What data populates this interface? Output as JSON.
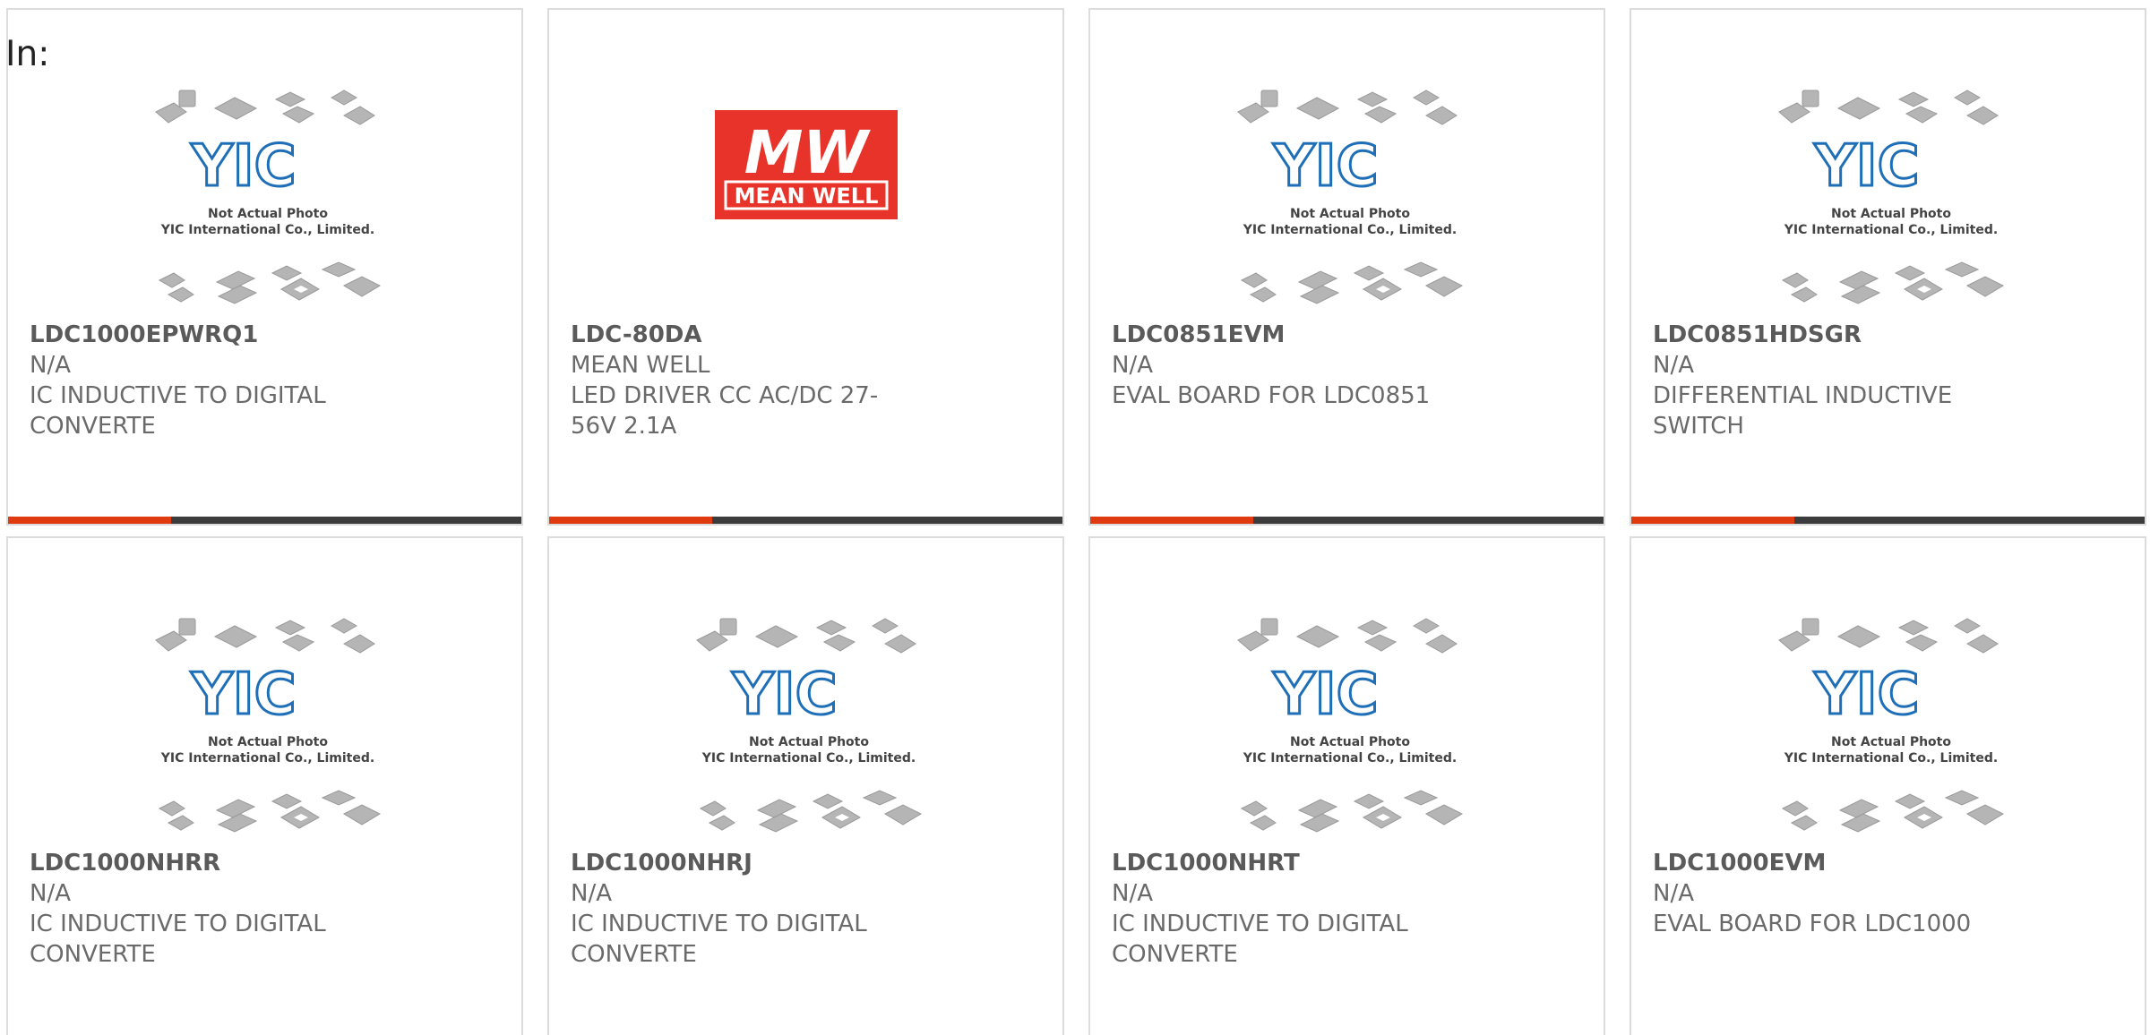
{
  "header": {
    "in_label": "In:"
  },
  "placeholder_logo": {
    "brand": "YIC",
    "caption_line1": "Not Actual Photo",
    "caption_line2": "YIC International Co., Limited."
  },
  "meanwell_logo": {
    "mark": "MW",
    "text": "MEAN WELL"
  },
  "colors": {
    "accent": "#e03a10",
    "bar": "#3c3c3c",
    "yic_blue": "#1e6fb8",
    "meanwell_red": "#e8332a"
  },
  "products": [
    {
      "part": "LDC1000EPWRQ1",
      "manufacturer": "N/A",
      "description": "IC INDUCTIVE TO DIGITAL CONVERTE",
      "image": "placeholder"
    },
    {
      "part": "LDC-80DA",
      "manufacturer": "MEAN WELL",
      "description": "LED DRIVER CC AC/DC 27-56V 2.1A",
      "image": "meanwell"
    },
    {
      "part": "LDC0851EVM",
      "manufacturer": "N/A",
      "description": "EVAL BOARD FOR LDC0851",
      "image": "placeholder"
    },
    {
      "part": "LDC0851HDSGR",
      "manufacturer": "N/A",
      "description": "DIFFERENTIAL INDUCTIVE SWITCH",
      "image": "placeholder"
    },
    {
      "part": "LDC1000NHRR",
      "manufacturer": "N/A",
      "description": "IC INDUCTIVE TO DIGITAL CONVERTE",
      "image": "placeholder"
    },
    {
      "part": "LDC1000NHRJ",
      "manufacturer": "N/A",
      "description": "IC INDUCTIVE TO DIGITAL CONVERTE",
      "image": "placeholder"
    },
    {
      "part": "LDC1000NHRT",
      "manufacturer": "N/A",
      "description": "IC INDUCTIVE TO DIGITAL CONVERTE",
      "image": "placeholder"
    },
    {
      "part": "LDC1000EVM",
      "manufacturer": "N/A",
      "description": "EVAL BOARD FOR LDC1000",
      "image": "placeholder"
    }
  ]
}
